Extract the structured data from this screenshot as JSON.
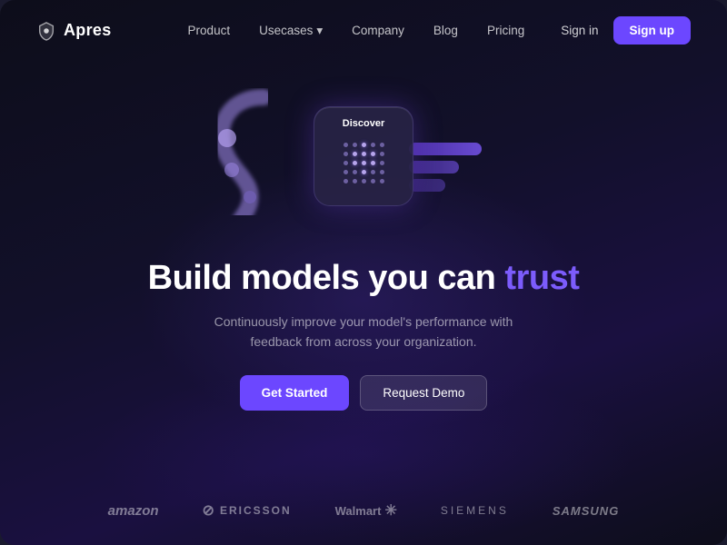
{
  "meta": {
    "brand_color": "#6c47ff",
    "accent_color": "#7c5cfc"
  },
  "navbar": {
    "logo_text": "Apres",
    "nav_items": [
      {
        "label": "Product",
        "has_dropdown": false
      },
      {
        "label": "Usecases",
        "has_dropdown": true
      },
      {
        "label": "Company",
        "has_dropdown": false
      },
      {
        "label": "Blog",
        "has_dropdown": false
      },
      {
        "label": "Pricing",
        "has_dropdown": false
      }
    ],
    "sign_in_label": "Sign in",
    "sign_up_label": "Sign up"
  },
  "hero": {
    "illustration_label": "Discover",
    "title_part1": "Build models you can ",
    "title_accent": "trust",
    "subtitle": "Continuously improve your model's performance with feedback from across your organization.",
    "cta_primary": "Get Started",
    "cta_secondary": "Request Demo"
  },
  "brands": [
    {
      "name": "amazon",
      "display": "amazon"
    },
    {
      "name": "ericsson",
      "display": "ERICSSON"
    },
    {
      "name": "walmart",
      "display": "Walmart"
    },
    {
      "name": "siemens",
      "display": "SIEMENS"
    },
    {
      "name": "samsung",
      "display": "SAMSUNG"
    }
  ]
}
